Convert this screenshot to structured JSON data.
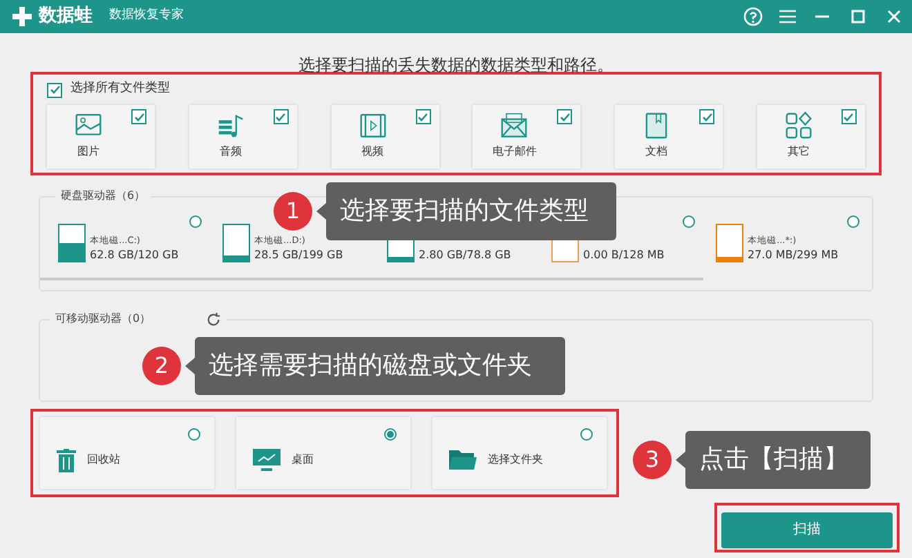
{
  "window": {
    "title": "数据蛙",
    "subtitle": "数据恢复专家"
  },
  "heading": "选择要扫描的丢失数据的数据类型和路径。",
  "file_types": {
    "select_all": {
      "label": "选择所有文件类型",
      "checked": true
    },
    "items": [
      {
        "label": "图片",
        "checked": true
      },
      {
        "label": "音频",
        "checked": true
      },
      {
        "label": "视频",
        "checked": true
      },
      {
        "label": "电子邮件",
        "checked": true
      },
      {
        "label": "文档",
        "checked": true
      },
      {
        "label": "其它",
        "checked": true
      }
    ]
  },
  "hard_drives": {
    "title": "硬盘驱动器（6）",
    "drives": [
      {
        "label": "本地磁...C:)",
        "size": "62.8 GB/120 GB",
        "level": 0.5,
        "color": "#1e958b",
        "selected": false
      },
      {
        "label": "本地磁...D:)",
        "size": "28.5 GB/199 GB",
        "level": 0.15,
        "color": "#1e958b"
      },
      {
        "size": "2.80 GB/78.8 GB",
        "level": 0.05,
        "color": "#1e958b"
      },
      {
        "size": "0.00  B/128 MB",
        "level": 0,
        "color": "#e8a050",
        "selected": false
      },
      {
        "label": "本地磁...*:)",
        "size": "27.0 MB/299 MB",
        "level": 0.12,
        "color": "#e8820c",
        "selected": false
      }
    ]
  },
  "removable": {
    "title": "可移动驱动器（0）"
  },
  "locations": [
    {
      "label": "回收站",
      "selected": false
    },
    {
      "label": "桌面",
      "selected": true
    },
    {
      "label": "选择文件夹",
      "selected": false
    }
  ],
  "scan_button": "扫描",
  "callouts": [
    {
      "number": "1",
      "text": "选择要扫描的文件类型"
    },
    {
      "number": "2",
      "text": "选择需要扫描的磁盘或文件夹"
    },
    {
      "number": "3",
      "text": "点击【扫描】"
    }
  ]
}
